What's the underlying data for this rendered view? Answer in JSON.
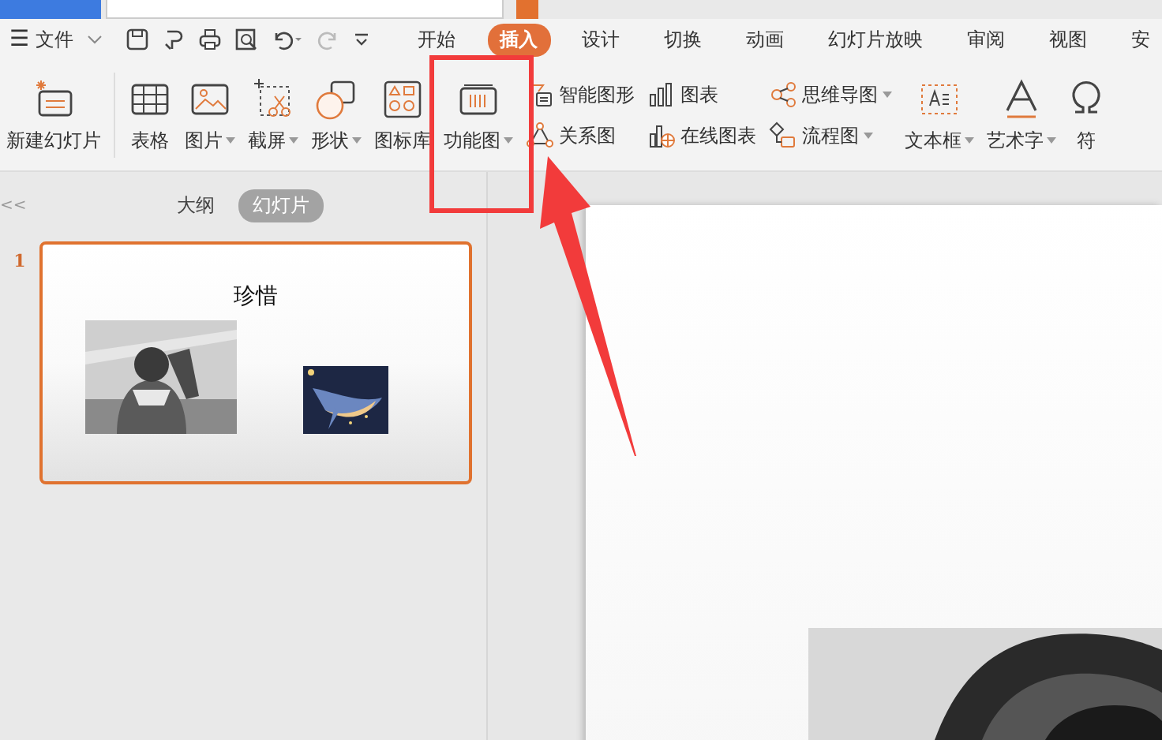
{
  "menu": {
    "icon": "☰",
    "label": "文件"
  },
  "quick_access": [
    {
      "kind": "save"
    },
    {
      "kind": "format-painter"
    },
    {
      "kind": "print"
    },
    {
      "kind": "preview"
    },
    {
      "kind": "undo"
    },
    {
      "kind": "redo"
    },
    {
      "kind": "more"
    }
  ],
  "tabs": [
    {
      "label": "开始",
      "selected": false
    },
    {
      "label": "插入",
      "selected": true
    },
    {
      "label": "设计",
      "selected": false
    },
    {
      "label": "切换",
      "selected": false
    },
    {
      "label": "动画",
      "selected": false
    },
    {
      "label": "幻灯片放映",
      "selected": false
    },
    {
      "label": "审阅",
      "selected": false
    },
    {
      "label": "视图",
      "selected": false
    },
    {
      "label": "安",
      "selected": false
    }
  ],
  "ribbon": {
    "large_left": [
      {
        "kind": "new-slide",
        "label": "新建幻灯片",
        "dropdown": false
      },
      {
        "kind": "table",
        "label": "表格",
        "dropdown": false
      },
      {
        "kind": "picture",
        "label": "图片",
        "dropdown": true
      },
      {
        "kind": "screenshot",
        "label": "截屏",
        "dropdown": true
      },
      {
        "kind": "shapes",
        "label": "形状",
        "dropdown": true
      },
      {
        "kind": "icon-library",
        "label": "图标库",
        "dropdown": false
      },
      {
        "kind": "function-chart",
        "label": "功能图",
        "dropdown": true
      }
    ],
    "small_columns": [
      [
        {
          "kind": "smart-art",
          "label": "智能图形",
          "dropdown": false
        },
        {
          "kind": "relation",
          "label": "关系图",
          "dropdown": false
        }
      ],
      [
        {
          "kind": "chart",
          "label": "图表",
          "dropdown": false
        },
        {
          "kind": "online-chart",
          "label": "在线图表",
          "dropdown": false
        }
      ],
      [
        {
          "kind": "mind-map",
          "label": "思维导图",
          "dropdown": true
        },
        {
          "kind": "flowchart",
          "label": "流程图",
          "dropdown": true
        }
      ]
    ],
    "large_right": [
      {
        "kind": "text-box",
        "label": "文本框",
        "dropdown": true
      },
      {
        "kind": "word-art",
        "label": "艺术字",
        "dropdown": true
      },
      {
        "kind": "symbol",
        "label": "符",
        "dropdown": false
      }
    ]
  },
  "panel": {
    "collapse": "<<",
    "views": [
      {
        "label": "大纲",
        "selected": false
      },
      {
        "label": "幻灯片",
        "selected": true
      }
    ],
    "slides": [
      {
        "number": "1",
        "title": "珍惜",
        "selected": true
      }
    ]
  }
}
